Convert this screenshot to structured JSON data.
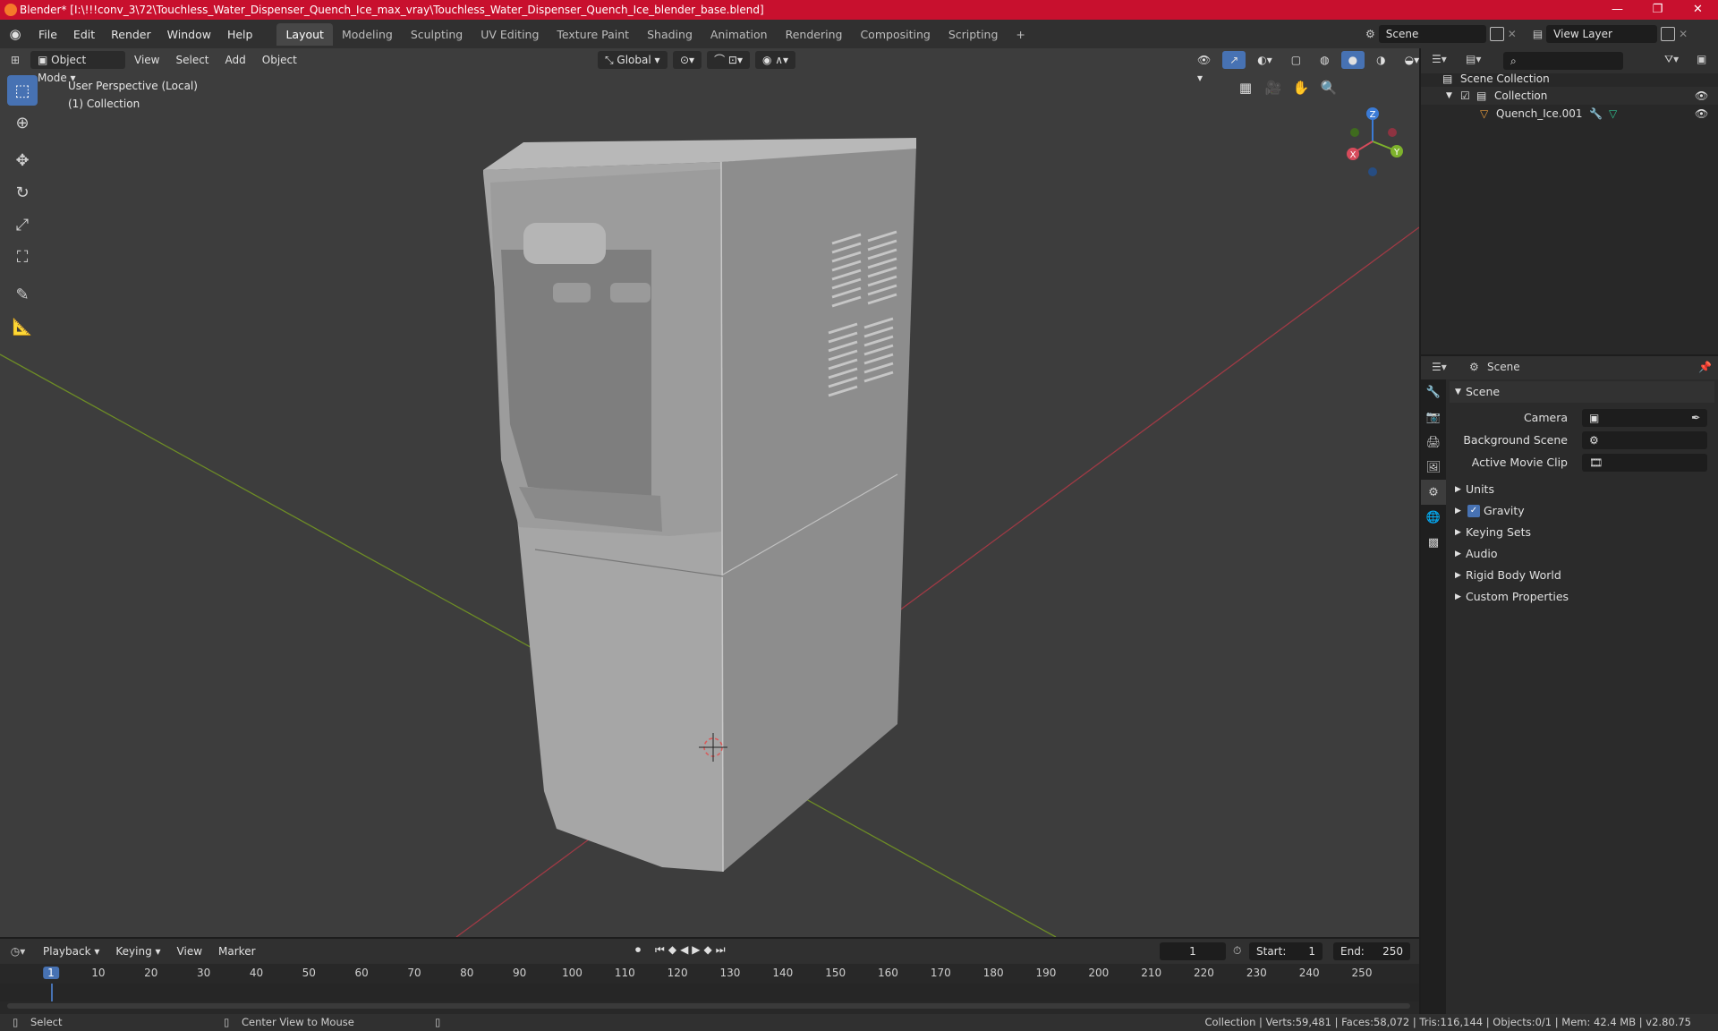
{
  "window": {
    "title": "Blender* [I:\\!!!conv_3\\72\\Touchless_Water_Dispenser_Quench_Ice_max_vray\\Touchless_Water_Dispenser_Quench_Ice_blender_base.blend]",
    "minimize": "—",
    "maximize": "❐",
    "close": "✕"
  },
  "menu": [
    "File",
    "Edit",
    "Render",
    "Window",
    "Help"
  ],
  "workspaces": [
    "Layout",
    "Modeling",
    "Sculpting",
    "UV Editing",
    "Texture Paint",
    "Shading",
    "Animation",
    "Rendering",
    "Compositing",
    "Scripting"
  ],
  "workspace_add": "+",
  "scene_selector": "Scene",
  "view_layer_selector": "View Layer",
  "viewport": {
    "mode": "Object Mode",
    "menus": [
      "View",
      "Select",
      "Add",
      "Object"
    ],
    "orientation": "Global",
    "info_line1": "User Perspective (Local)",
    "info_line2": "(1) Collection",
    "axis_labels": {
      "z": "Z",
      "y": "Y",
      "x": "X"
    },
    "colors": {
      "bg": "#3d3d3d",
      "x_axis": "#b8434e",
      "y_axis": "#7a9c2a",
      "active": "#4772b3"
    }
  },
  "outliner": {
    "root": "Scene Collection",
    "collection": "Collection",
    "object": "Quench_Ice.001"
  },
  "properties": {
    "header": "Scene",
    "panel": "Scene",
    "fields": [
      {
        "label": "Camera"
      },
      {
        "label": "Background Scene"
      },
      {
        "label": "Active Movie Clip"
      }
    ],
    "sections": [
      "Units",
      "Gravity",
      "Keying Sets",
      "Audio",
      "Rigid Body World",
      "Custom Properties"
    ],
    "gravity_checked": true
  },
  "timeline": {
    "menus": [
      "Playback",
      "Keying",
      "View",
      "Marker"
    ],
    "current_frame": "1",
    "start_label": "Start:",
    "start": "1",
    "end_label": "End:",
    "end": "250",
    "ruler": [
      "1",
      "10",
      "20",
      "30",
      "40",
      "50",
      "60",
      "70",
      "80",
      "90",
      "100",
      "110",
      "120",
      "130",
      "140",
      "150",
      "160",
      "170",
      "180",
      "190",
      "200",
      "210",
      "220",
      "230",
      "240",
      "250"
    ]
  },
  "status": {
    "left": "Select",
    "middle": "Center View to Mouse",
    "right": "Collection | Verts:59,481 | Faces:58,072 | Tris:116,144 | Objects:0/1 | Mem: 42.4 MB | v2.80.75"
  }
}
